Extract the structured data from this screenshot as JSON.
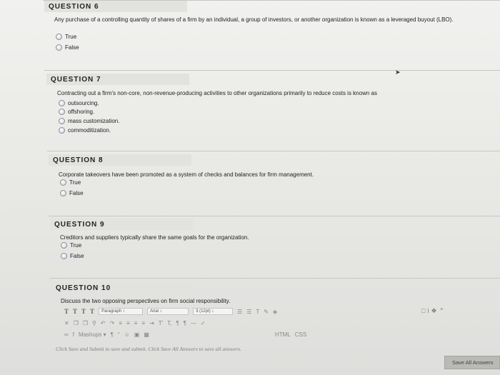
{
  "questions": [
    {
      "title": "QUESTION 6",
      "text": "Any purchase of a controlling quantity of shares of a firm by an individual, a group of investors, or another organization is known as a leveraged buyout (LBO).",
      "options": [
        "True",
        "False"
      ]
    },
    {
      "title": "QUESTION 7",
      "text": "Contracting out a firm's non-core, non-revenue-producing activities to other organizations primarily to reduce costs is known as",
      "options": [
        "outsourcing.",
        "offshoring.",
        "mass customization.",
        "commoditization."
      ]
    },
    {
      "title": "QUESTION 8",
      "text": "Corporate takeovers have been promoted as a system of checks and balances for firm management.",
      "options": [
        "True",
        "False"
      ]
    },
    {
      "title": "QUESTION 9",
      "text": "Creditors and suppliers typically share the same goals for the organization.",
      "options": [
        "True",
        "False"
      ]
    },
    {
      "title": "QUESTION 10",
      "text": "Discuss the two opposing perspectives on firm social responsibility."
    }
  ],
  "editor": {
    "format_buttons": [
      "T",
      "T",
      "T",
      "T"
    ],
    "paragraph_select": "Paragraph",
    "font_select": "Arial",
    "size_select": "3 (12pt)",
    "mashups_label": "Mashups",
    "html_label": "HTML",
    "css_label": "CSS",
    "superscript_label": "T'",
    "subscript_label": "T,"
  },
  "hint_text": "Click Save and Submit to save and submit. Click Save All Answers to save all answers.",
  "save_all_label": "Save All Answers"
}
